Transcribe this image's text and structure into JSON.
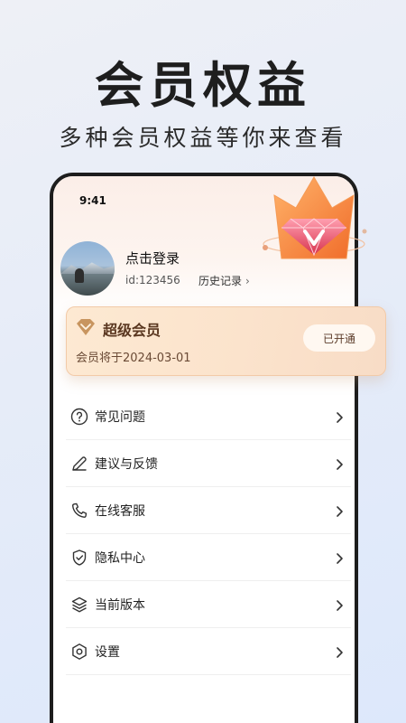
{
  "poster": {
    "title": "会员权益",
    "subtitle": "多种会员权益等你来查看"
  },
  "status_bar": {
    "time": "9:41"
  },
  "profile": {
    "login_text": "点击登录",
    "user_id": "id:123456",
    "history_label": "历史记录",
    "history_chevron": "›"
  },
  "vip_card": {
    "title": "超级会员",
    "expiry_text": "会员将于2024-03-01",
    "button_label": "已开通"
  },
  "menu": {
    "items": [
      {
        "label": "常见问题",
        "icon": "question-circle-icon"
      },
      {
        "label": "建议与反馈",
        "icon": "pencil-icon"
      },
      {
        "label": "在线客服",
        "icon": "phone-icon"
      },
      {
        "label": "隐私中心",
        "icon": "shield-check-icon"
      },
      {
        "label": "当前版本",
        "icon": "layers-icon"
      },
      {
        "label": "设置",
        "icon": "gear-hexagon-icon"
      }
    ]
  },
  "colors": {
    "vip_card_bg": "#fde9d2",
    "vip_title": "#5a3720",
    "crown_primary": "#f58a3a",
    "gem": "#e8506c"
  }
}
